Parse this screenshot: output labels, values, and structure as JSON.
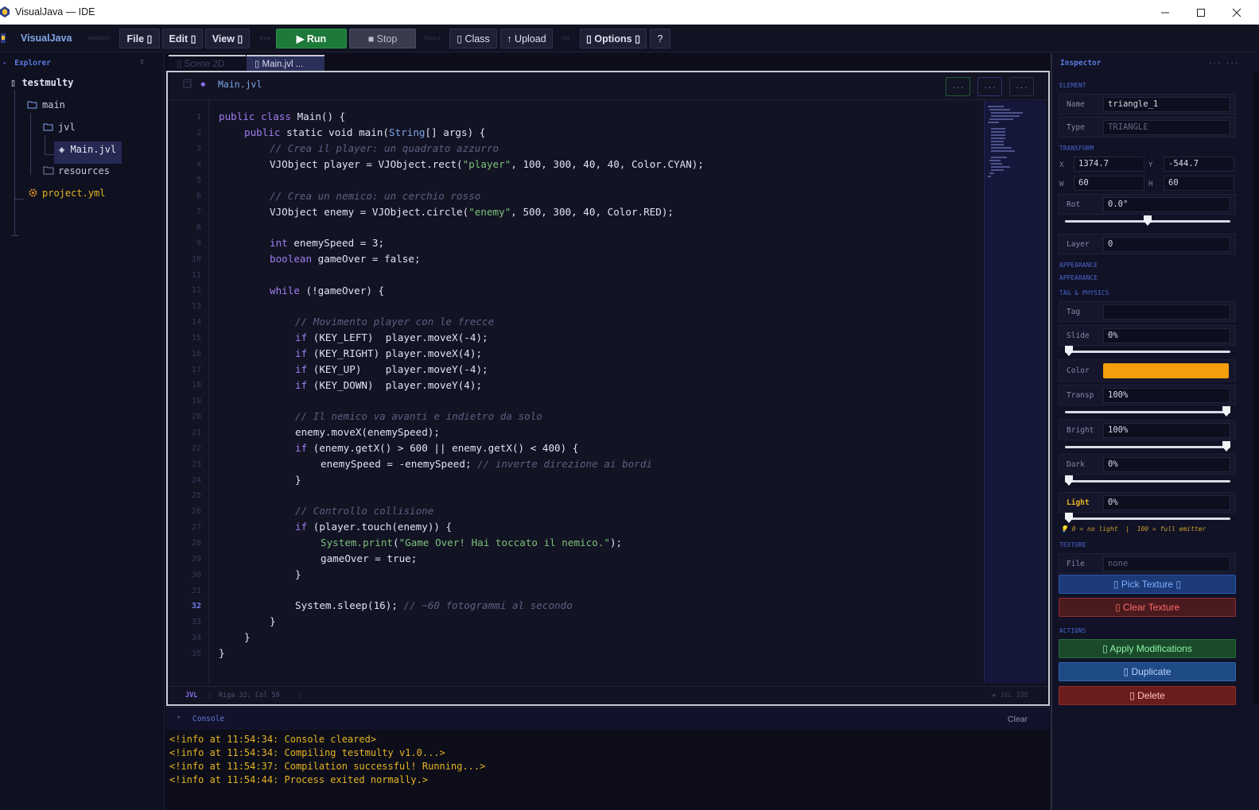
{
  "window": {
    "title": "VisualJava — IDE",
    "controls": {
      "minimize": "─",
      "maximize": "☐",
      "close": "✕"
    }
  },
  "toolbar": {
    "brand": "VisualJava",
    "groups": {
      "project": "PROJECT",
      "run": "RUN",
      "tools": "TOOLS",
      "ide": "IDE"
    },
    "file": "File ▯",
    "edit": "Edit ▯",
    "view": "View ▯",
    "run": "▶  Run",
    "stop": "■  Stop",
    "class": "▯ Class",
    "upload": "↑ Upload",
    "options": "▯ Options ▯",
    "help": "?"
  },
  "explorer": {
    "title": "Explorer",
    "collapse": "▯",
    "tree": {
      "root": "▯ testmulty",
      "main": "main",
      "jvl": "jvl",
      "file": "◈ Main.jvl",
      "resources": "resources",
      "project": "project.yml"
    }
  },
  "editor": {
    "tabs": [
      {
        "label": "▯ Scene 2D"
      },
      {
        "label": "▯ Main.jvl  ..."
      }
    ],
    "file_title": "Main.jvl",
    "header_buttons": [
      "...",
      "...",
      "..."
    ],
    "active_line": 32,
    "line_numbers": [
      "1",
      "2",
      "3",
      "4",
      "5",
      "6",
      "7",
      "8",
      "9",
      "10",
      "11",
      "12",
      "13",
      "14",
      "15",
      "16",
      "17",
      "18",
      "19",
      "20",
      "21",
      "22",
      "23",
      "24",
      "25",
      "26",
      "27",
      "28",
      "29",
      "30",
      "31",
      "32",
      "33",
      "34",
      "35"
    ],
    "code": {
      "l1": {
        "k1": "public",
        "k2": "class",
        "t": " Main() {"
      },
      "l2": {
        "k1": "public",
        "t1": " static void ",
        "f": "main",
        "t2": "(",
        "ty": "String",
        "t3": "[] args) {"
      },
      "l3": "// Crea il player: un quadrato azzurro",
      "l4": {
        "a": "VJObject player = VJObject.rect(",
        "s": "\"player\"",
        "b": ", 100, 300, 40, 40, Color.CYAN);"
      },
      "l6": "// Crea un nemico: un cerchio rosso",
      "l7": {
        "a": "VJObject enemy = VJObject.circle(",
        "s": "\"enemy\"",
        "b": ", 500, 300, 40, Color.RED);"
      },
      "l9": {
        "k": "int",
        "t": " enemySpeed = 3;"
      },
      "l10": {
        "k": "boolean",
        "t": " gameOver = false;"
      },
      "l12": {
        "k": "while",
        "t": " (!gameOver) {"
      },
      "l14": "// Movimento player con le frecce",
      "l15": {
        "k": "if",
        "t": " (KEY_LEFT)  player.moveX(-4);"
      },
      "l16": {
        "k": "if",
        "t": " (KEY_RIGHT) player.moveX(4);"
      },
      "l17": {
        "k": "if",
        "t": " (KEY_UP)    player.moveY(-4);"
      },
      "l18": {
        "k": "if",
        "t": " (KEY_DOWN)  player.moveY(4);"
      },
      "l20": "// Il nemico va avanti e indietro da solo",
      "l21": "enemy.moveX(enemySpeed);",
      "l22": {
        "k": "if",
        "t": " (enemy.getX() > 600 || enemy.getX() < 400) {"
      },
      "l23": {
        "t": "enemySpeed = -enemySpeed; ",
        "c": "// inverte direzione ai bordi"
      },
      "l24": "}",
      "l26": "// Controllo collisione",
      "l27": {
        "k": "if",
        "t": " (player.touch(enemy)) {"
      },
      "l28": {
        "sys": "System.print",
        "a": "(",
        "s": "\"Game Over! Hai toccato il nemico.\"",
        "b": ");"
      },
      "l29": "gameOver = true;",
      "l30": "}",
      "l32": {
        "t": "System.sleep(16); ",
        "c": "// ~60 fotogrammi al secondo"
      },
      "l33": "}",
      "l34": "}",
      "l35": "}"
    },
    "status": {
      "lang": "JVL",
      "sep": "|",
      "position": "Riga 32, Col 59",
      "sep2": "|",
      "right": "◈ JVL IDE"
    }
  },
  "console": {
    "title": "Console",
    "clear": "Clear",
    "lines": [
      "<!info at 11:54:34: Console cleared>",
      "<!info at 11:54:34: Compiling testmulty v1.0...>",
      "<!info at 11:54:37: Compilation successful! Running...>",
      "<!info at 11:54:44: Process exited normally.>"
    ]
  },
  "inspector": {
    "title": "Inspector",
    "head_icons": [
      "...",
      "..."
    ],
    "sections": {
      "element": "ELEMENT",
      "transform": "TRANSFORM",
      "appearance1": "APPEARANCE",
      "appearance2": "APPEARANCE",
      "tag_physics": "TAG & PHYSICS",
      "texture": "TEXTURE",
      "actions": "ACTIONS"
    },
    "name_label": "Name",
    "name_value": "triangle_1",
    "type_label": "Type",
    "type_value": "TRIANGLE",
    "x_label": "X",
    "x_value": "1374.7",
    "y_label": "Y",
    "y_value": "-544.7",
    "w_label": "W",
    "w_value": "60",
    "h_label": "H",
    "h_value": "60",
    "rot_label": "Rot",
    "rot_value": "0.0°",
    "rot_fraction": 0.5,
    "layer_label": "Layer",
    "layer_value": "0",
    "tag_label": "Tag",
    "tag_value": "",
    "slide_label": "Slide",
    "slide_value": "0%",
    "slide_fraction": 0,
    "color_label": "Color",
    "color_hex": "#f59e0b",
    "transp_label": "Transp",
    "transp_value": "100%",
    "transp_fraction": 1,
    "bright_label": "Bright",
    "bright_value": "100%",
    "bright_fraction": 1,
    "dark_label": "Dark",
    "dark_value": "0%",
    "dark_fraction": 0,
    "light_label": "Light",
    "light_value": "0%",
    "light_fraction": 0,
    "light_hint": "💡 0 = no light  |  100 = full emitter",
    "file_label": "File",
    "file_value": "none",
    "pick_texture": "▯ Pick Texture ▯",
    "clear_texture": "▯ Clear Texture",
    "apply": "▯ Apply Modifications",
    "duplicate": "▯ Duplicate",
    "delete": "▯ Delete"
  },
  "colors": {
    "accent": "#5d7ae0",
    "run": "#1e7a3a",
    "console_text": "#e6b422",
    "keyword": "#a17df0",
    "string": "#7cc07b",
    "comment": "#5c6080",
    "apply": "#1f6b33",
    "duplicate": "#2d5f9e",
    "delete": "#8e2525",
    "clear_texture": "#6e2224"
  }
}
